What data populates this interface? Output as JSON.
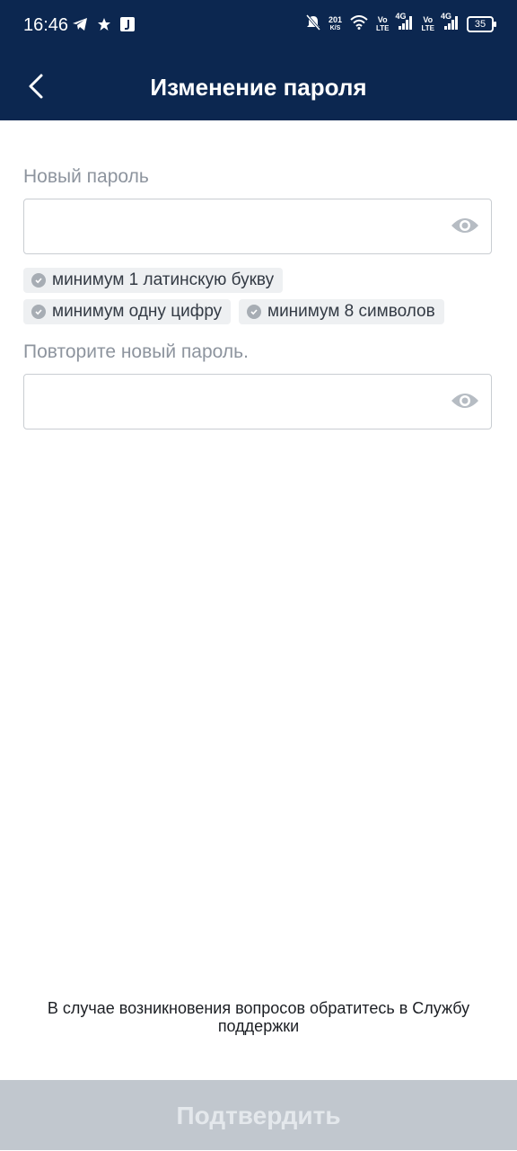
{
  "status_bar": {
    "time": "16:46",
    "net_speed_value": "201",
    "net_speed_unit": "K/S",
    "sim1_top": "Vo",
    "sim1_bottom": "LTE",
    "sim1_net": "4G",
    "sim2_top": "Vo",
    "sim2_bottom": "LTE",
    "sim2_net": "4G",
    "battery": "35",
    "icons": [
      "telegram-icon",
      "star-icon",
      "app-j-icon",
      "mute-icon",
      "wifi-icon",
      "signal-icon",
      "battery-icon"
    ]
  },
  "header": {
    "title": "Изменение пароля",
    "back_icon": "chevron-left-icon"
  },
  "form": {
    "new_password_label": "Новый пароль",
    "new_password_value": "",
    "repeat_password_label": "Повторите новый пароль.",
    "repeat_password_value": "",
    "eye_icon": "eye-icon"
  },
  "requirements": [
    "минимум 1 латинскую букву",
    "минимум одну цифру",
    "минимум 8 символов"
  ],
  "footer": {
    "support_text": "В случае возникновения вопросов обратитесь в Службу поддержки",
    "confirm_label": "Подтвердить"
  },
  "colors": {
    "header_bg": "#0c2750",
    "button_disabled_bg": "#c1c7ce",
    "chip_bg": "#eef0f2"
  }
}
